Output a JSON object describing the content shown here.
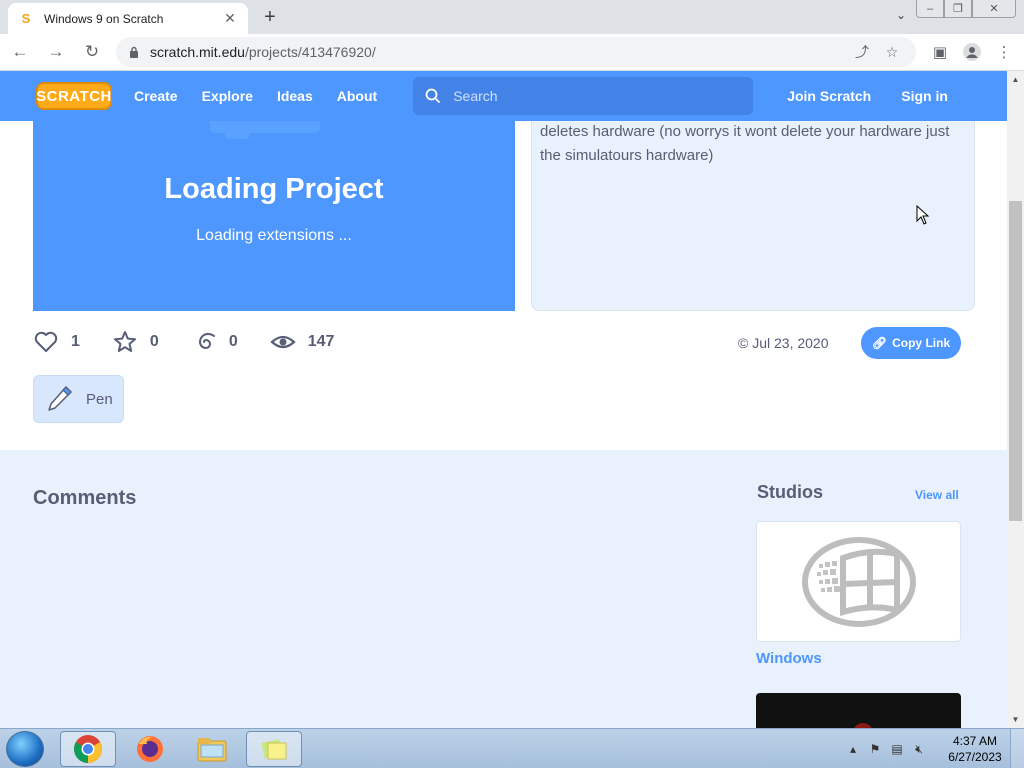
{
  "browser": {
    "tab_title": "Windows 9 on Scratch",
    "tab_favicon": "S",
    "url_host": "scratch.mit.edu",
    "url_path": "/projects/413476920/"
  },
  "nav": {
    "logo": "SCRATCH",
    "links": [
      "Create",
      "Explore",
      "Ideas",
      "About"
    ],
    "search_placeholder": "Search",
    "join": "Join Scratch",
    "signin": "Sign in"
  },
  "project": {
    "loading_title": "Loading Project",
    "loading_sub": "Loading extensions ...",
    "notes_text": "deletes hardware (no worrys it wont delete your hardware just the simulatours hardware)",
    "loves": "1",
    "favorites": "0",
    "remixes": "0",
    "views": "147",
    "date": "© Jul 23, 2020",
    "copy_link": "Copy Link",
    "extension_tag": "Pen"
  },
  "comments": {
    "title": "Comments"
  },
  "studios": {
    "title": "Studios",
    "view_all": "View all",
    "items": [
      {
        "name": "Windows"
      }
    ]
  },
  "taskbar": {
    "time": "4:37 AM",
    "date": "6/27/2023"
  },
  "colors": {
    "scratch_blue": "#4d97ff",
    "page_bg": "#e9f1fc",
    "text": "#575e75"
  }
}
